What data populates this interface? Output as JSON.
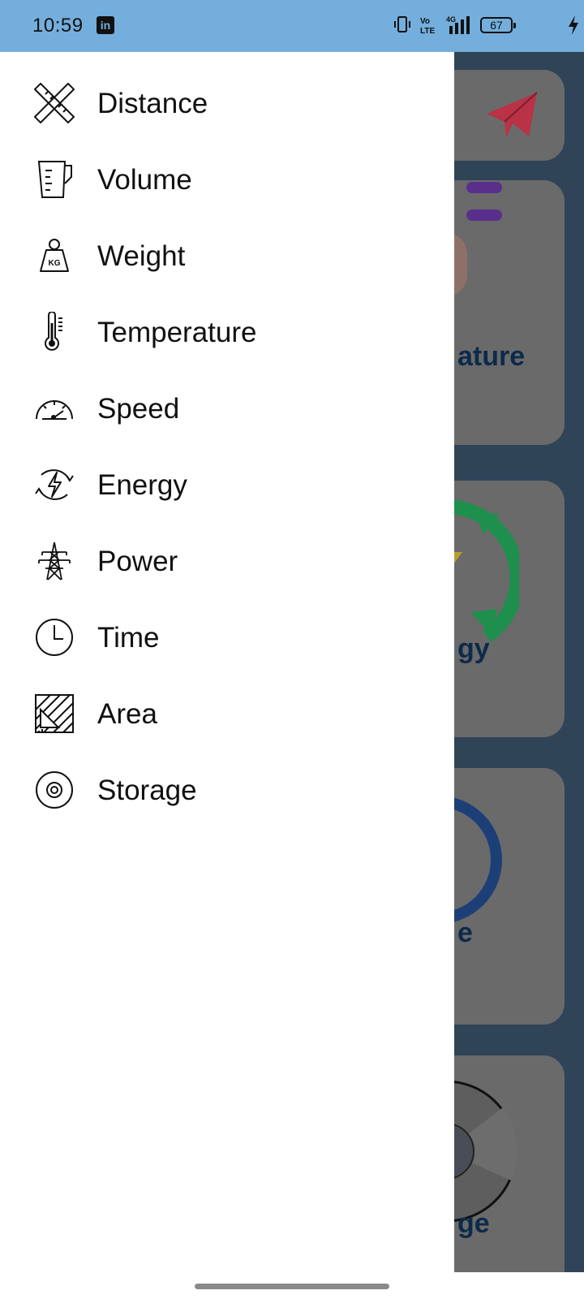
{
  "status_bar": {
    "time": "10:59",
    "notification_app": "in",
    "battery_level": "67",
    "icons": [
      "linkedin-icon",
      "vibrate-icon",
      "volte-icon",
      "4g-signal-icon",
      "battery-icon",
      "charging-icon"
    ]
  },
  "drawer": {
    "items": [
      {
        "label": "Distance",
        "icon": "ruler-pencil-icon"
      },
      {
        "label": "Volume",
        "icon": "measuring-jug-icon"
      },
      {
        "label": "Weight",
        "icon": "kg-weight-icon"
      },
      {
        "label": "Temperature",
        "icon": "thermometer-icon"
      },
      {
        "label": "Speed",
        "icon": "speedometer-icon"
      },
      {
        "label": "Energy",
        "icon": "energy-cycle-icon"
      },
      {
        "label": "Power",
        "icon": "power-tower-icon"
      },
      {
        "label": "Time",
        "icon": "clock-icon"
      },
      {
        "label": "Area",
        "icon": "area-triangle-icon"
      },
      {
        "label": "Storage",
        "icon": "disc-icon"
      }
    ],
    "weight_icon_text": "KG"
  },
  "background": {
    "card_labels": [
      "ature",
      "gy",
      "e",
      "ge"
    ],
    "accent_colors": {
      "send": "#c0304a",
      "menu": "#5a2f8c",
      "energy": "#1f8f4e",
      "time_ring": "#1d3f78"
    }
  },
  "colors": {
    "status_bar": "#74aedc",
    "drawer": "#ffffff",
    "overlay_bg": "#2f4457"
  }
}
